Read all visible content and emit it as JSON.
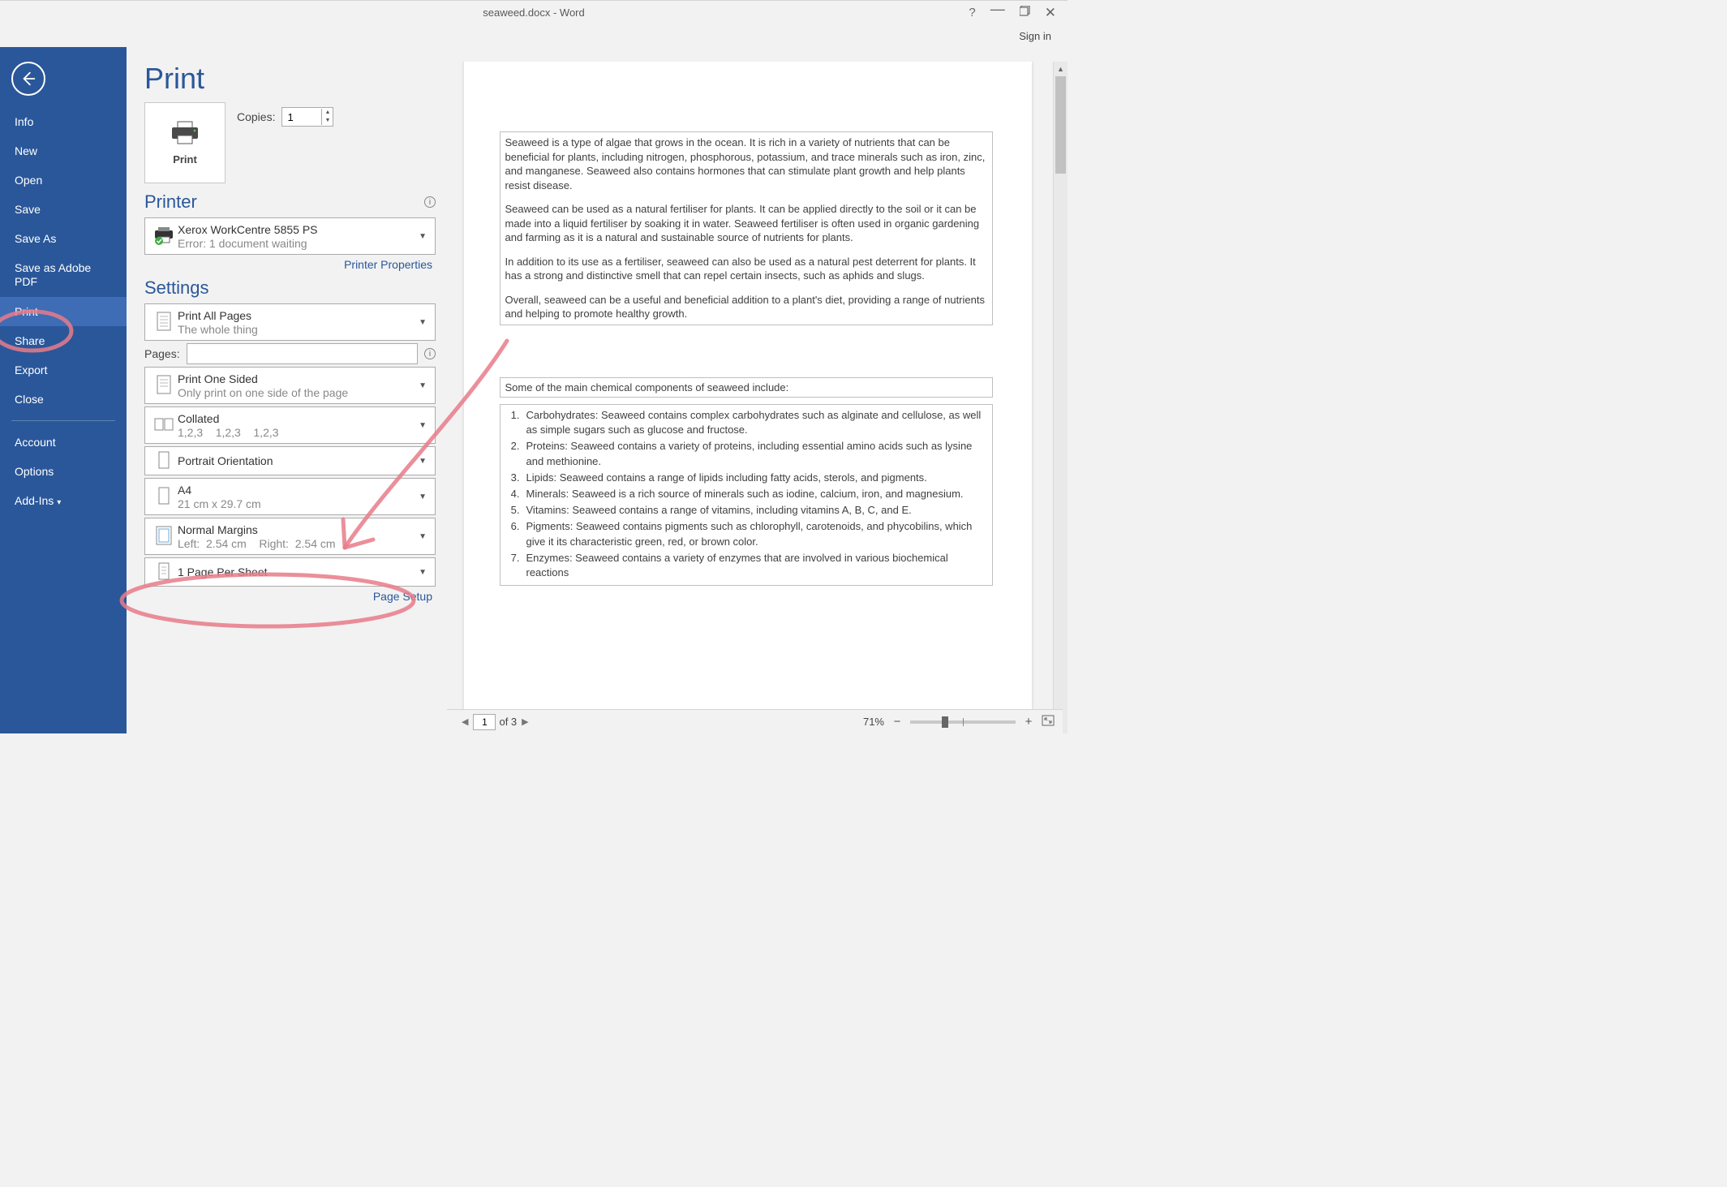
{
  "titlebar": {
    "title": "seaweed.docx - Word"
  },
  "signin": "Sign in",
  "sidebar": {
    "items": [
      {
        "label": "Info"
      },
      {
        "label": "New"
      },
      {
        "label": "Open"
      },
      {
        "label": "Save"
      },
      {
        "label": "Save As"
      },
      {
        "label": "Save as Adobe PDF"
      },
      {
        "label": "Print",
        "active": true
      },
      {
        "label": "Share"
      },
      {
        "label": "Export"
      },
      {
        "label": "Close"
      }
    ],
    "items2": [
      {
        "label": "Account"
      },
      {
        "label": "Options"
      },
      {
        "label": "Add-Ins",
        "caret": true
      }
    ]
  },
  "page_title": "Print",
  "print_btn": "Print",
  "copies_label": "Copies:",
  "copies_value": "1",
  "printer": {
    "heading": "Printer",
    "name": "Xerox WorkCentre 5855 PS",
    "status": "Error: 1 document waiting",
    "properties_link": "Printer Properties"
  },
  "settings": {
    "heading": "Settings",
    "print_all": {
      "line1": "Print All Pages",
      "line2": "The whole thing"
    },
    "pages_label": "Pages:",
    "sided": {
      "line1": "Print One Sided",
      "line2": "Only print on one side of the page"
    },
    "collated": {
      "line1": "Collated",
      "line2": "1,2,3    1,2,3    1,2,3"
    },
    "orientation": {
      "line1": "Portrait Orientation"
    },
    "paper": {
      "line1": "A4",
      "line2": "21 cm x 29.7 cm"
    },
    "margins": {
      "line1": "Normal Margins",
      "line2": "Left:  2.54 cm    Right:  2.54 cm"
    },
    "per_sheet": {
      "line1": "1 Page Per Sheet"
    },
    "page_setup_link": "Page Setup"
  },
  "preview": {
    "p1": "Seaweed is a type of algae that grows in the ocean. It is rich in a variety of nutrients that can be beneficial for plants, including nitrogen, phosphorous, potassium, and trace minerals such as iron, zinc, and manganese. Seaweed also contains hormones that can stimulate plant growth and help plants resist disease.",
    "p2": "Seaweed can be used as a natural fertiliser for plants. It can be applied directly to the soil or it can be made into a liquid fertiliser by soaking it in water. Seaweed fertiliser is often used in organic gardening and farming as it is a natural and sustainable source of nutrients for plants.",
    "p3": "In addition to its use as a fertiliser, seaweed can also be used as a natural pest deterrent for plants. It has a strong and distinctive smell that can repel certain insects, such as aphids and slugs.",
    "p4": "Overall, seaweed can be a useful and beneficial addition to a plant's diet, providing a range of nutrients and helping to promote healthy growth.",
    "box2": "Some of the main chemical components of seaweed include:",
    "list": [
      "Carbohydrates: Seaweed contains complex carbohydrates such as alginate and cellulose, as well as simple sugars such as glucose and fructose.",
      "Proteins: Seaweed contains a variety of proteins, including essential amino acids such as lysine and methionine.",
      "Lipids: Seaweed contains a range of lipids including fatty acids, sterols, and pigments.",
      "Minerals: Seaweed is a rich source of minerals such as iodine, calcium, iron, and magnesium.",
      "Vitamins: Seaweed contains a range of vitamins, including vitamins A, B, C, and E.",
      "Pigments: Seaweed contains pigments such as chlorophyll, carotenoids, and phycobilins, which give it its characteristic green, red, or brown color.",
      "Enzymes: Seaweed contains a variety of enzymes that are involved in various biochemical reactions"
    ]
  },
  "pager": {
    "current": "1",
    "of": "of 3"
  },
  "zoom": {
    "pct": "71%"
  }
}
